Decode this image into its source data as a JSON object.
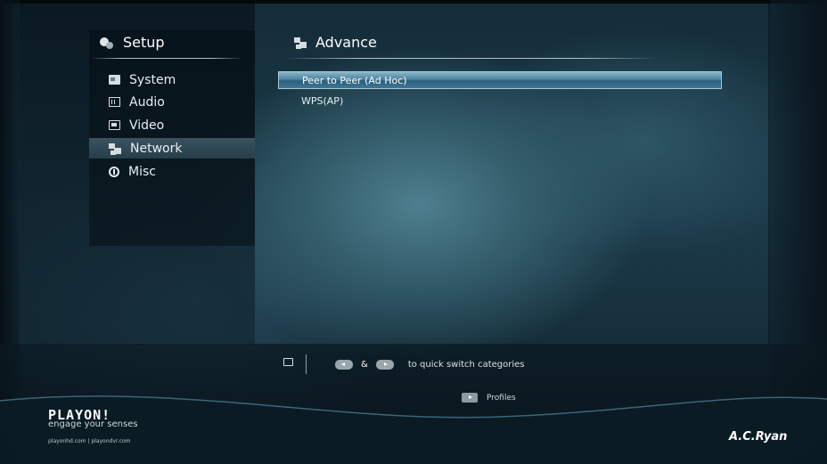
{
  "sidebar": {
    "title": "Setup",
    "items": [
      {
        "label": "System",
        "icon": "system-icon"
      },
      {
        "label": "Audio",
        "icon": "audio-icon"
      },
      {
        "label": "Video",
        "icon": "video-icon"
      },
      {
        "label": "Network",
        "icon": "network-icon",
        "active": true
      },
      {
        "label": "Misc",
        "icon": "info-icon"
      }
    ]
  },
  "main": {
    "title": "Advance",
    "options": [
      {
        "label": "Peer to Peer (Ad Hoc)",
        "selected": true
      },
      {
        "label": "WPS(AP)"
      }
    ]
  },
  "footer": {
    "hint_amp": "&",
    "hint_text": "to quick switch categories",
    "profiles_label": "Profiles"
  },
  "branding": {
    "logo": "PLAYON!",
    "tagline": "engage your senses",
    "urls": "playonhd.com | playondvr.com",
    "maker": "A.C.Ryan"
  },
  "colors": {
    "selection": "#4d84a0",
    "active_menu": "#3a5360",
    "text": "#e8eef2"
  }
}
